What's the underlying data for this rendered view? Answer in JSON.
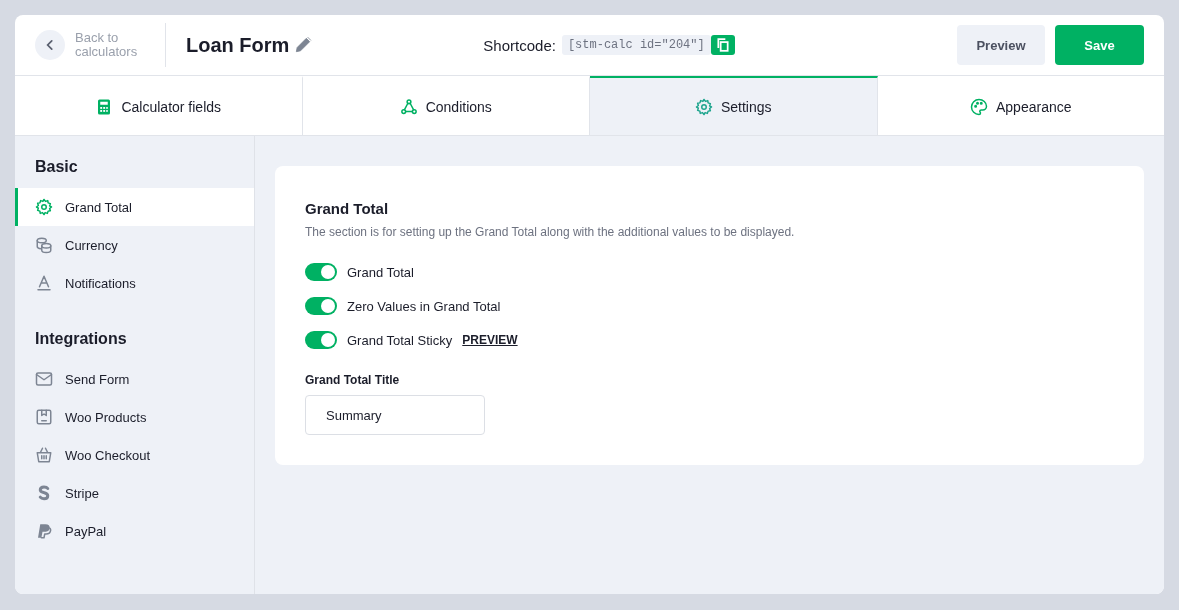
{
  "header": {
    "back_label": "Back to calculators",
    "title": "Loan Form",
    "shortcode_label": "Shortcode:",
    "shortcode": "[stm-calc id=\"204\"]",
    "buttons": [
      {
        "label": "Preview",
        "kind": "secondary"
      },
      {
        "label": "Save",
        "kind": "primary"
      }
    ]
  },
  "tabs": [
    {
      "label": "Calculator fields",
      "selected": false
    },
    {
      "label": "Conditions",
      "selected": false
    },
    {
      "label": "Settings",
      "selected": true
    },
    {
      "label": "Appearance",
      "selected": false
    }
  ],
  "sidebar": [
    {
      "heading": "Basic",
      "items": [
        {
          "label": "Grand Total",
          "selected": true
        },
        {
          "label": "Currency",
          "selected": false
        },
        {
          "label": "Notifications",
          "selected": false
        }
      ]
    },
    {
      "heading": "Integrations",
      "items": [
        {
          "label": "Send Form",
          "selected": false
        },
        {
          "label": "Woo Products",
          "selected": false
        },
        {
          "label": "Woo Checkout",
          "selected": false
        },
        {
          "label": "Stripe",
          "selected": false
        },
        {
          "label": "PayPal",
          "selected": false
        }
      ]
    }
  ],
  "panel": {
    "title": "Grand Total",
    "description": "The section is for setting up the Grand Total along with the additional values to be displayed.",
    "toggles": [
      {
        "label": "Grand Total",
        "on": true
      },
      {
        "label": "Zero Values in Grand Total",
        "on": true
      },
      {
        "label": "Grand Total Sticky",
        "on": true,
        "link": "PREVIEW"
      }
    ],
    "field": {
      "label": "Grand Total Title",
      "value": "Summary"
    }
  }
}
